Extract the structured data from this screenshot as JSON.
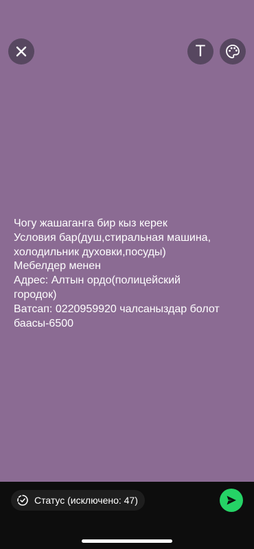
{
  "colors": {
    "canvas_background": "#8b6b93",
    "toolbar_button": "#574760",
    "bottom_bar": "#0d0d0d",
    "send_button": "#25d366",
    "text": "#ffffff"
  },
  "toolbar": {
    "close_icon": "close-x",
    "text_tool_label": "T",
    "palette_icon": "palette"
  },
  "status": {
    "lines": [
      "Чогу жашаганга бир кыз керек",
      "Условия бар(душ,стиральная машина,",
      "холодильник духовки,посуды)",
      "Мебелдер менен",
      "Адрес: Алтын ордо(полицейский",
      "городок)",
      "Ватсап: 0220959920 чалсаныздар болот",
      "баасы-6500"
    ]
  },
  "bottom_bar": {
    "audience_label": "Статус (исключено: 47)",
    "audience_icon": "status-ring",
    "send_icon": "send-arrow"
  }
}
